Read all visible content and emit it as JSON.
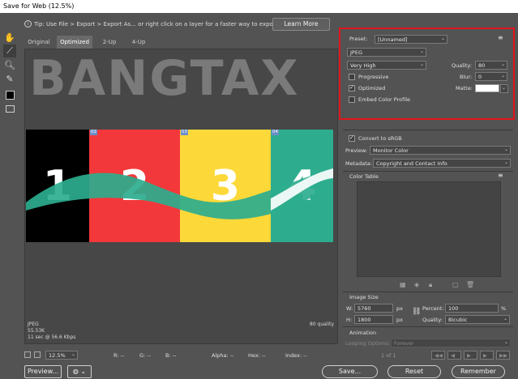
{
  "window": {
    "title": "Save for Web (12.5%)"
  },
  "tip": {
    "text": "Tip: Use File > Export > Export As...  or right click on a layer for a faster way to export assets",
    "learn_more": "Learn More"
  },
  "tabs": [
    {
      "label": "Original"
    },
    {
      "label": "Optimized"
    },
    {
      "label": "2-Up"
    },
    {
      "label": "4-Up"
    }
  ],
  "preview": {
    "watermark": "BANGTAX",
    "slices": [
      {
        "tag": "02",
        "number": "2",
        "color": "#f2383a"
      },
      {
        "tag": "03",
        "number": "3",
        "color": "#fcd939"
      },
      {
        "tag": "04",
        "number": "4",
        "color": "#2dad8e"
      }
    ],
    "first_number": "1",
    "info_left": [
      "JPEG",
      "55.53K",
      "11 sec @ 56.6 Kbps"
    ],
    "info_right": "80 quality"
  },
  "status": {
    "zoom": "12.5%",
    "r": "R: --",
    "g": "G: --",
    "b": "B: --",
    "alpha": "Alpha: --",
    "hex": "Hex: --",
    "index": "Index: --"
  },
  "settings": {
    "preset_label": "Preset:",
    "preset_value": "[Unnamed]",
    "format": "JPEG",
    "compression": "Very High",
    "quality_label": "Quality:",
    "quality_value": "80",
    "progressive": "Progressive",
    "blur_label": "Blur:",
    "blur_value": "0",
    "optimized": "Optimized",
    "matte_label": "Matte:",
    "embed_profile": "Embed Color Profile",
    "convert_srgb": "Convert to sRGB",
    "preview_label": "Preview:",
    "preview_value": "Monitor Color",
    "metadata_label": "Metadata:",
    "metadata_value": "Copyright and Contact Info"
  },
  "color_table": {
    "title": "Color Table"
  },
  "image_size": {
    "title": "Image Size",
    "w_label": "W:",
    "w_value": "5760",
    "h_label": "H:",
    "h_value": "1800",
    "unit": "px",
    "percent_label": "Percent:",
    "percent_value": "100",
    "percent_unit": "%",
    "quality_label": "Quality:",
    "quality_value": "Bicubic"
  },
  "animation": {
    "title": "Animation",
    "looping_label": "Looping Options:",
    "looping_value": "Forever",
    "frame": "1 of 1"
  },
  "buttons": {
    "preview": "Preview...",
    "save": "Save...",
    "reset": "Reset",
    "remember": "Remember"
  },
  "colors": {
    "highlight": "#e0141a",
    "panel_bg": "#535353"
  }
}
